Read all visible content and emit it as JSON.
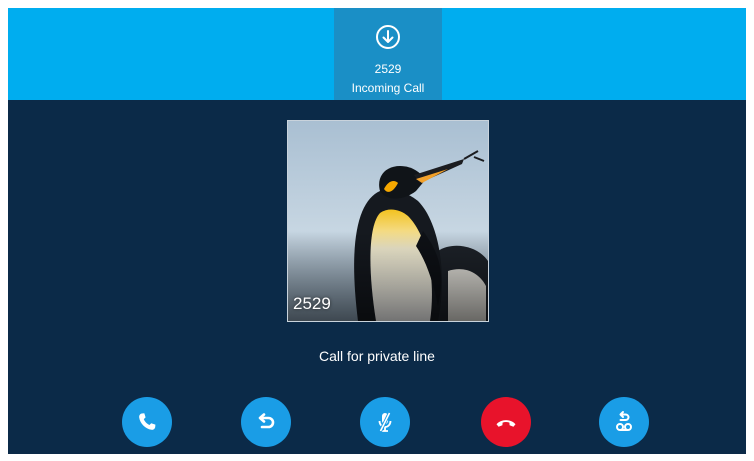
{
  "header": {
    "caller_number": "2529",
    "status": "Incoming Call",
    "icon": "download-arrow-icon"
  },
  "contact": {
    "photo_caption": "2529"
  },
  "call_info": {
    "line_label": "Call for private line"
  },
  "actions": [
    {
      "name": "answer",
      "icon": "phone-icon",
      "color": "#1a9de6"
    },
    {
      "name": "forward",
      "icon": "return-arrow-icon",
      "color": "#1a9de6"
    },
    {
      "name": "silence",
      "icon": "mic-off-icon",
      "color": "#1a9de6"
    },
    {
      "name": "reject",
      "icon": "hang-up-icon",
      "color": "#e8132b"
    },
    {
      "name": "voicemail",
      "icon": "voicemail-icon",
      "color": "#1a9de6"
    }
  ],
  "colors": {
    "top_bar": "#00adef",
    "active_tab": "#1a8fc6",
    "background": "#0b2a48"
  }
}
